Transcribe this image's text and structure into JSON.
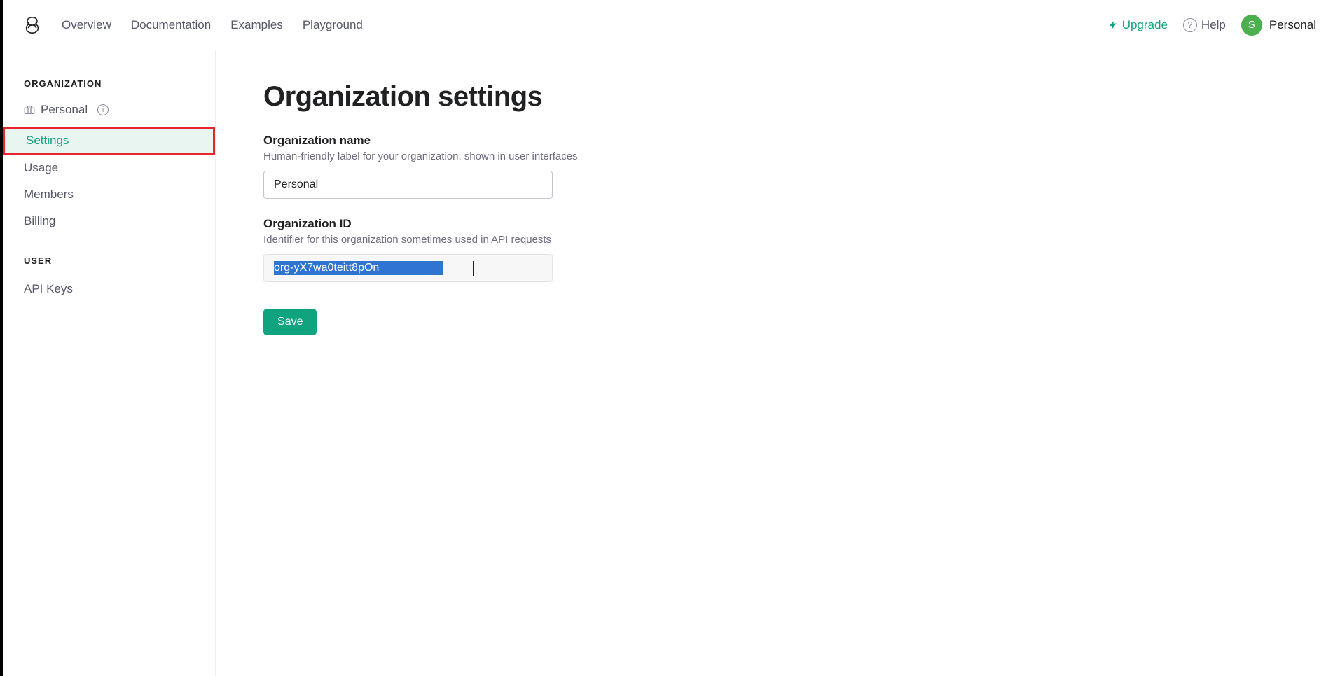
{
  "nav": {
    "items": [
      "Overview",
      "Documentation",
      "Examples",
      "Playground"
    ],
    "upgrade": "Upgrade",
    "help": "Help",
    "profile_name": "Personal",
    "avatar_initial": "S"
  },
  "sidebar": {
    "org_section": "ORGANIZATION",
    "org_name": "Personal",
    "items": [
      "Settings",
      "Usage",
      "Members",
      "Billing"
    ],
    "user_section": "USER",
    "user_items": [
      "API Keys"
    ]
  },
  "main": {
    "title": "Organization settings",
    "org_name": {
      "label": "Organization name",
      "hint": "Human-friendly label for your organization, shown in user interfaces",
      "value": "Personal"
    },
    "org_id": {
      "label": "Organization ID",
      "hint": "Identifier for this organization sometimes used in API requests",
      "value_visible": "org-yX7wa0teitt8pOn"
    },
    "save": "Save"
  }
}
